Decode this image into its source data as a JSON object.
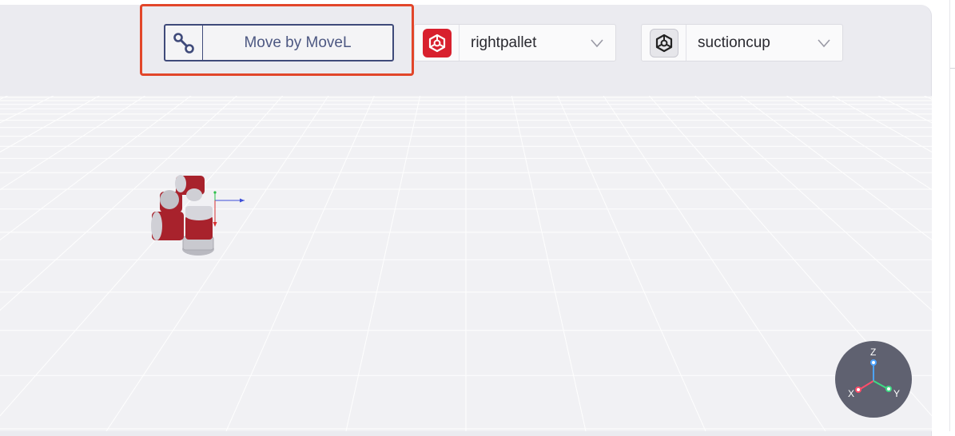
{
  "toolbar": {
    "move_label": "Move by MoveL",
    "pallet_dropdown": {
      "value": "rightpallet",
      "icon": "pallet-cube-icon",
      "accent": "#d8202e"
    },
    "tool_dropdown": {
      "value": "suctioncup",
      "icon": "tool-cube-icon"
    }
  },
  "gizmo": {
    "z_label": "Z",
    "x_label": "X",
    "y_label": "Y",
    "z_color": "#4da3ff",
    "x_color": "#ff4d6a",
    "y_color": "#3ddc84"
  },
  "colors": {
    "highlight": "#e2462a",
    "robot_body": "#a8222c",
    "move_border": "#3f4a7a"
  }
}
